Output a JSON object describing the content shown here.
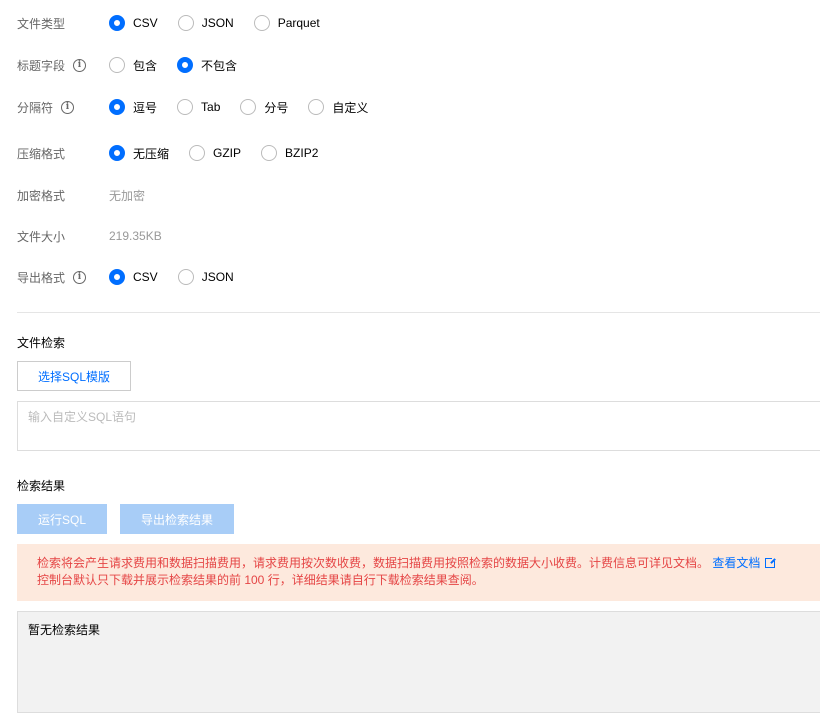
{
  "settings": {
    "file_type": {
      "label": "文件类型",
      "options": [
        "CSV",
        "JSON",
        "Parquet"
      ],
      "selected": 0
    },
    "header_field": {
      "label": "标题字段",
      "options": [
        "包含",
        "不包含"
      ],
      "selected": 1
    },
    "delimiter": {
      "label": "分隔符",
      "options": [
        "逗号",
        "Tab",
        "分号",
        "自定义"
      ],
      "selected": 0
    },
    "compression": {
      "label": "压缩格式",
      "options": [
        "无压缩",
        "GZIP",
        "BZIP2"
      ],
      "selected": 0
    },
    "encryption": {
      "label": "加密格式",
      "value": "无加密"
    },
    "file_size": {
      "label": "文件大小",
      "value": "219.35KB"
    },
    "export_format": {
      "label": "导出格式",
      "options": [
        "CSV",
        "JSON"
      ],
      "selected": 0
    }
  },
  "search": {
    "title": "文件检索",
    "template_button": "选择SQL模版",
    "input_placeholder": "输入自定义SQL语句"
  },
  "results": {
    "title": "检索结果",
    "run_button": "运行SQL",
    "export_button": "导出检索结果",
    "notice_line1": "检索将会产生请求费用和数据扫描费用，请求费用按次数收费，数据扫描费用按照检索的数据大小收费。计费信息可详见文档。",
    "notice_link": "查看文档",
    "notice_line2": "控制台默认只下载并展示检索结果的前 100 行，详细结果请自行下载检索结果查阅。",
    "empty_text": "暂无检索结果"
  },
  "colors": {
    "accent": "#006eff",
    "disabled_button": "#a8cdf7",
    "notice_bg": "#fde9dd",
    "notice_text": "#e54545"
  }
}
